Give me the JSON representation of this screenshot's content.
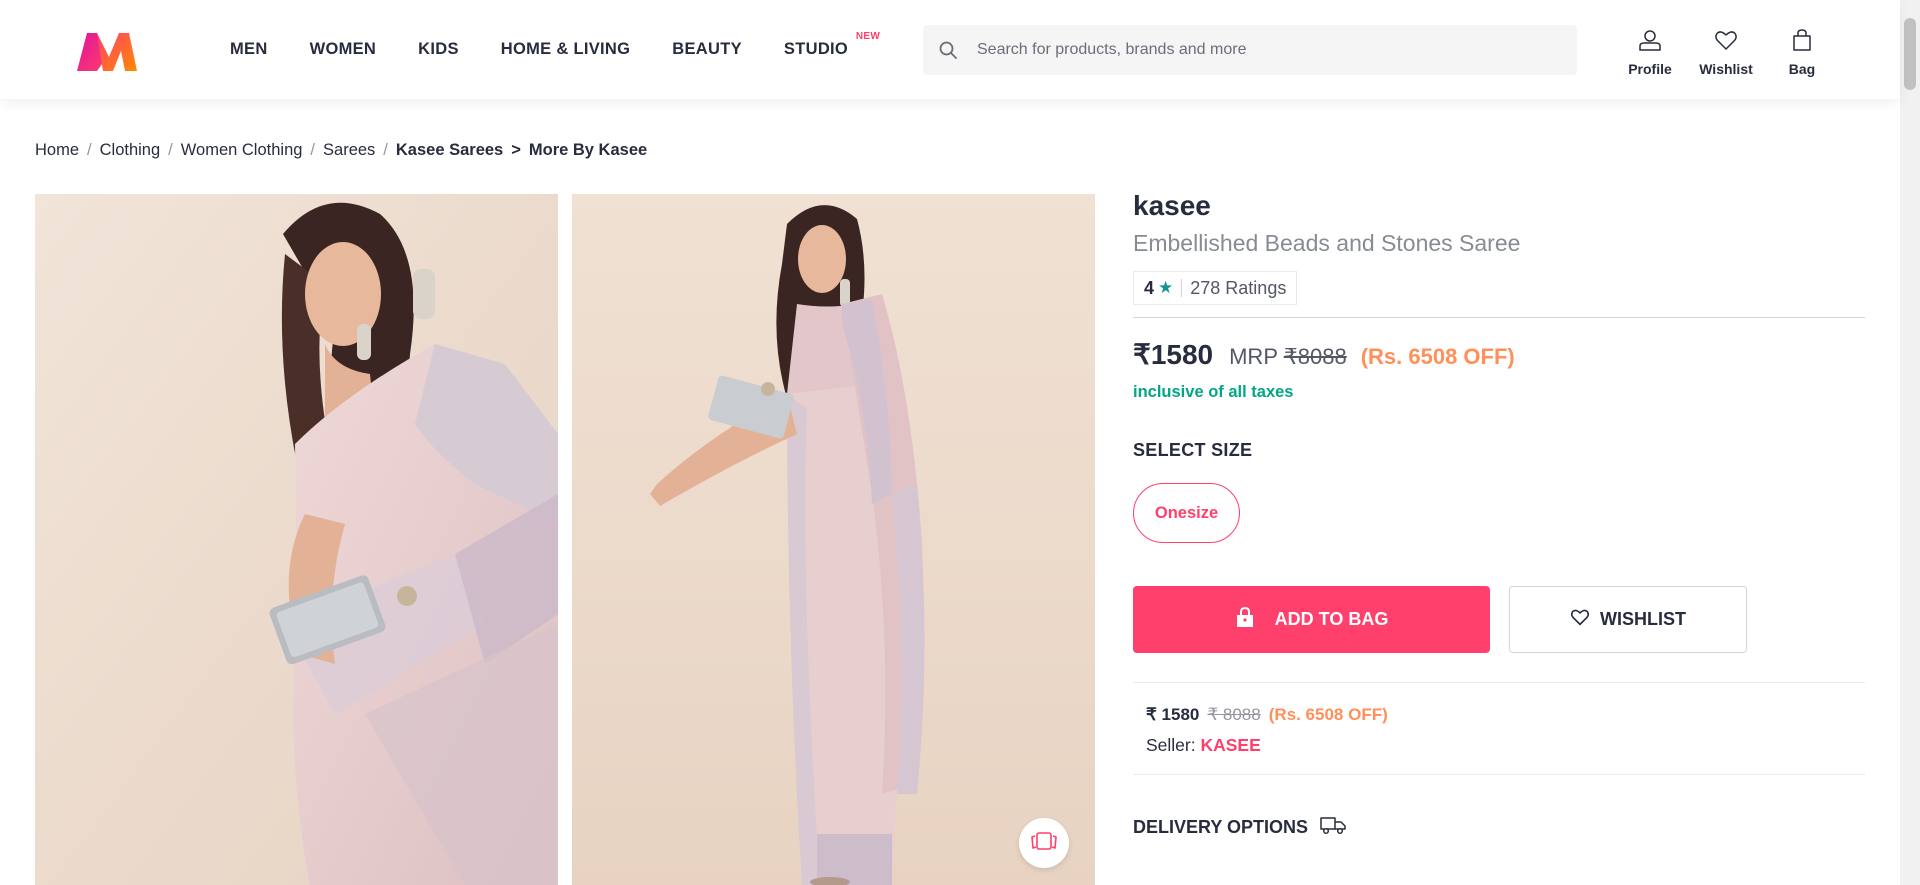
{
  "header": {
    "nav": [
      {
        "label": "MEN"
      },
      {
        "label": "WOMEN"
      },
      {
        "label": "KIDS"
      },
      {
        "label": "HOME & LIVING"
      },
      {
        "label": "BEAUTY"
      },
      {
        "label": "STUDIO",
        "badge": "NEW"
      }
    ],
    "search": {
      "placeholder": "Search for products, brands and more"
    },
    "actions": {
      "profile": "Profile",
      "wishlist": "Wishlist",
      "bag": "Bag"
    }
  },
  "breadcrumb": {
    "items": [
      "Home",
      "Clothing",
      "Women Clothing",
      "Sarees"
    ],
    "current": "Kasee Sarees",
    "arrow": ">",
    "more": "More By Kasee"
  },
  "product": {
    "brand": "kasee",
    "name": "Embellished Beads and Stones Saree",
    "rating": {
      "value": "4",
      "count": "278 Ratings"
    },
    "price": "₹1580",
    "mrp_label": "MRP",
    "mrp": "₹8088",
    "discount": "(Rs. 6508 OFF)",
    "tax_note": "inclusive of all taxes",
    "select_size_label": "SELECT SIZE",
    "sizes": [
      "Onesize"
    ],
    "add_to_bag": "ADD TO BAG",
    "wishlist": "WISHLIST",
    "seller_offer": {
      "price": "₹ 1580",
      "mrp": "₹ 8088",
      "discount": "(Rs. 6508 OFF)",
      "seller_label": "Seller:",
      "seller_name": "KASEE"
    },
    "delivery_label": "DELIVERY OPTIONS"
  },
  "colors": {
    "accent": "#ff3f6c",
    "discount": "#ff905a",
    "tax": "#03a685",
    "rating_star": "#14958f"
  }
}
